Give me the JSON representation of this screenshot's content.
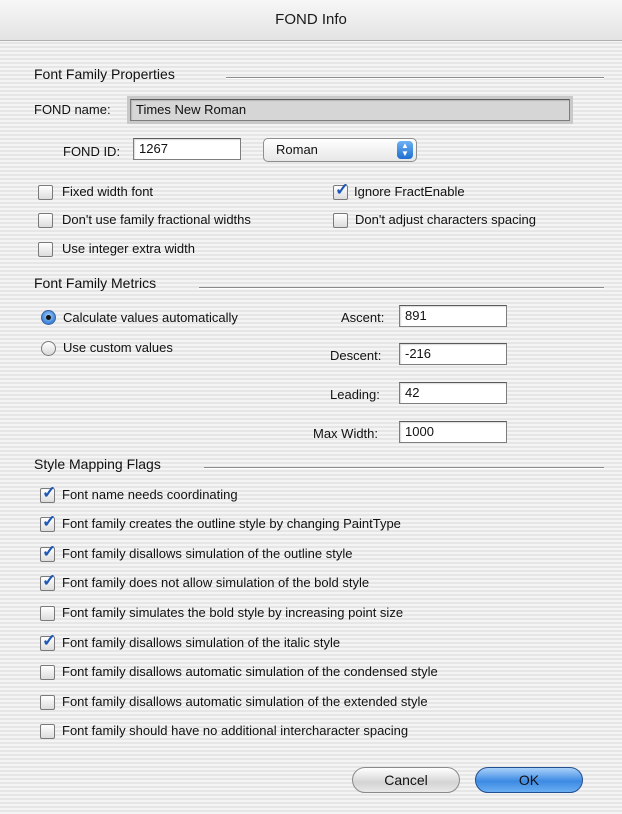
{
  "window": {
    "title": "FOND Info"
  },
  "properties": {
    "section_title": "Font Family Properties",
    "fond_name_label": "FOND name:",
    "fond_name_value": "Times New Roman",
    "fond_id_label": "FOND ID:",
    "fond_id_value": "1267",
    "style_popup_value": "Roman",
    "checkboxes": [
      {
        "label": "Fixed width font",
        "checked": false
      },
      {
        "label": "Ignore FractEnable",
        "checked": true
      },
      {
        "label": "Don't use family fractional widths",
        "checked": false
      },
      {
        "label": "Don't adjust characters spacing",
        "checked": false
      },
      {
        "label": "Use integer extra width",
        "checked": false
      }
    ]
  },
  "metrics": {
    "section_title": "Font Family Metrics",
    "radio_auto_label": "Calculate values automatically",
    "radio_custom_label": "Use custom values",
    "selected": "auto",
    "ascent_label": "Ascent:",
    "ascent_value": "891",
    "descent_label": "Descent:",
    "descent_value": "-216",
    "leading_label": "Leading:",
    "leading_value": "42",
    "maxwidth_label": "Max Width:",
    "maxwidth_value": "1000"
  },
  "style_flags": {
    "section_title": "Style Mapping Flags",
    "items": [
      {
        "label": "Font name needs coordinating",
        "checked": true
      },
      {
        "label": "Font family creates the outline style by changing PaintType",
        "checked": true
      },
      {
        "label": "Font family disallows simulation of the outline style",
        "checked": true
      },
      {
        "label": "Font family does not allow simulation of the bold style",
        "checked": true
      },
      {
        "label": "Font family simulates the bold style by increasing point size",
        "checked": false
      },
      {
        "label": "Font family disallows simulation of the italic style",
        "checked": true
      },
      {
        "label": "Font family disallows automatic simulation of the condensed style",
        "checked": false
      },
      {
        "label": "Font family disallows automatic simulation of the extended style",
        "checked": false
      },
      {
        "label": "Font family should have no additional intercharacter spacing",
        "checked": false
      }
    ]
  },
  "buttons": {
    "cancel": "Cancel",
    "ok": "OK"
  },
  "colors": {
    "accent": "#3c8ae3",
    "checkmark": "#1d58b8"
  }
}
